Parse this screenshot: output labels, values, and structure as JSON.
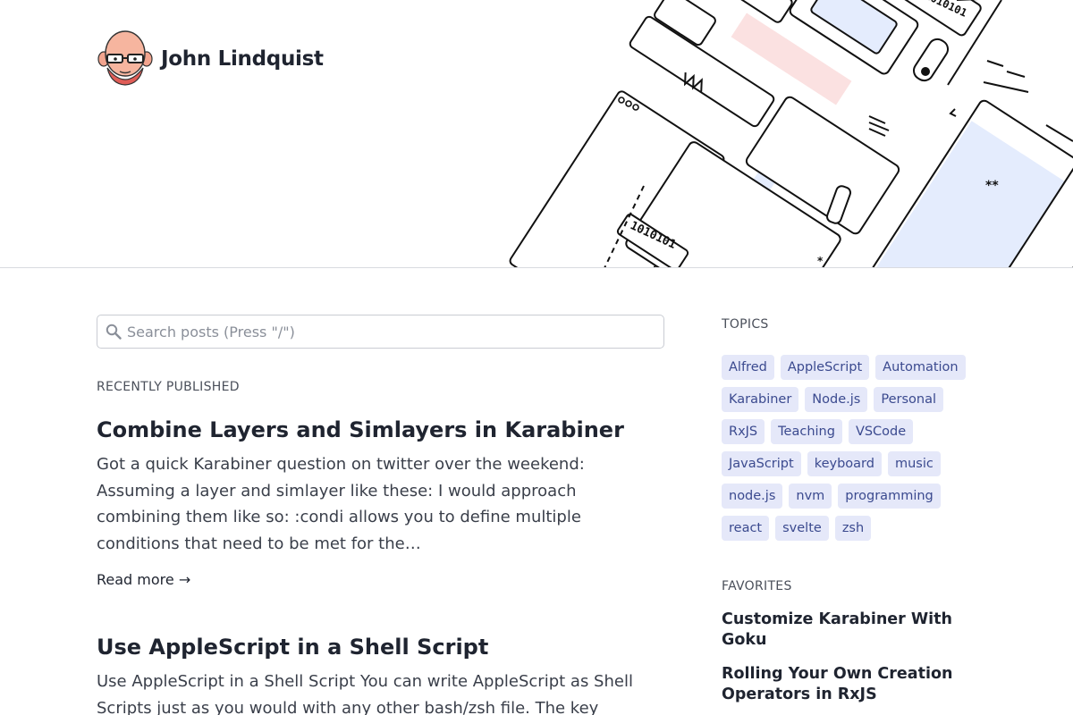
{
  "site": {
    "author_name": "John Lindquist"
  },
  "search": {
    "placeholder": "Search posts (Press \"/\")"
  },
  "recent": {
    "label": "RECENTLY PUBLISHED",
    "posts": [
      {
        "title": "Combine Layers and Simlayers in Karabiner",
        "excerpt": "Got a quick Karabiner question on twitter over the weekend: Assuming a layer and simlayer like these: I would approach combining them like so: :condi allows you to define multiple conditions that need to be met for the…",
        "read_more": "Read more →"
      },
      {
        "title": "Use AppleScript in a Shell Script",
        "excerpt": "Use AppleScript in a Shell Script You can write AppleScript as Shell Scripts just as you would with any other bash/zsh file. The key requirement is that"
      }
    ]
  },
  "topics": {
    "label": "TOPICS",
    "tags": [
      "Alfred",
      "AppleScript",
      "Automation",
      "Karabiner",
      "Node.js",
      "Personal",
      "RxJS",
      "Teaching",
      "VSCode",
      "JavaScript",
      "keyboard",
      "music",
      "node.js",
      "nvm",
      "programming",
      "react",
      "svelte",
      "zsh"
    ]
  },
  "favorites": {
    "label": "FAVORITES",
    "items": [
      "Customize Karabiner With Goku",
      "Rolling Your Own Creation Operators in RxJS"
    ]
  },
  "hero_art": {
    "binary_1": "1010101",
    "binary_2": "1010101",
    "colors": {
      "pink": "#fbe1e1",
      "blue": "#e4ecfd",
      "stroke": "#111111"
    }
  },
  "colors": {
    "tag_bg": "#e5e8f9",
    "tag_text": "#3b4a8f",
    "text": "#1f2430",
    "divider": "#d9dbe0"
  }
}
